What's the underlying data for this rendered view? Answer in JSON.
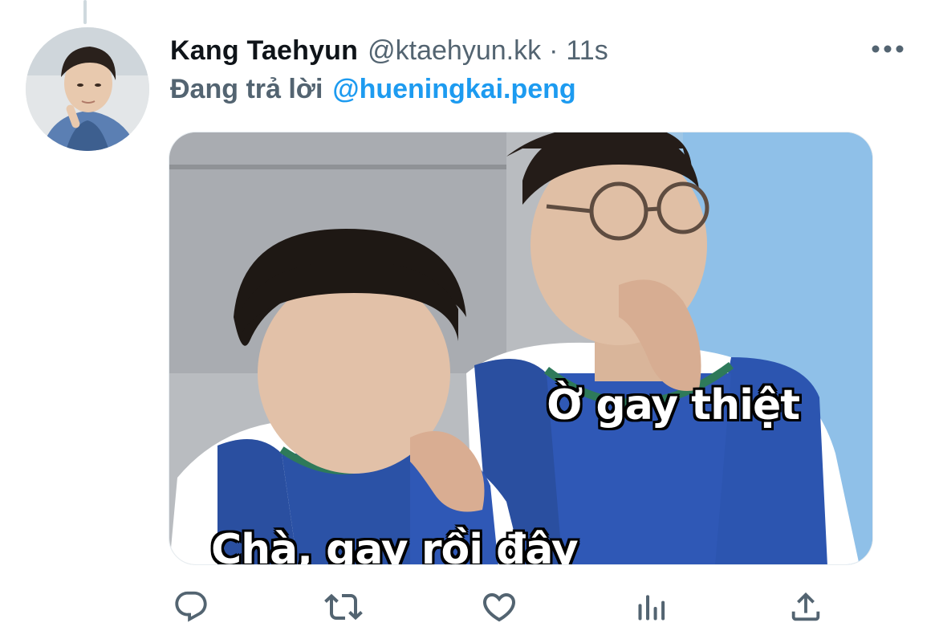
{
  "tweet": {
    "display_name": "Kang Taehyun",
    "handle": "@ktaehyun.kk",
    "separator": "·",
    "time": "11s",
    "reply_prefix": "Đang trả lời",
    "reply_mention": "@hueningkai.peng"
  },
  "media": {
    "caption_top": "Ờ gay thiệt",
    "caption_bottom": "Chà, gay rồi đây"
  },
  "actions": [
    {
      "icon": "reply-icon"
    },
    {
      "icon": "retweet-icon"
    },
    {
      "icon": "like-icon"
    },
    {
      "icon": "analytics-icon"
    },
    {
      "icon": "share-icon"
    }
  ],
  "colors": {
    "text_primary": "#0f1419",
    "text_secondary": "#536471",
    "accent": "#1d9bf0"
  }
}
